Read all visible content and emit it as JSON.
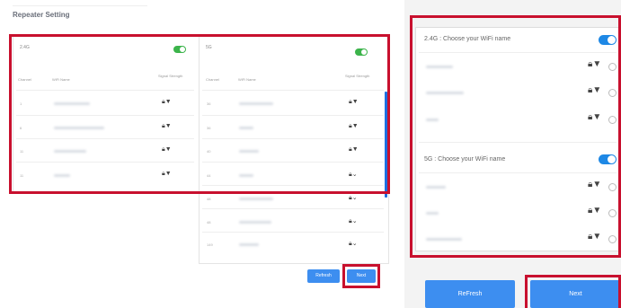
{
  "page": {
    "title": "Repeater Setting"
  },
  "left_panel": {
    "band_24": "2.4G",
    "band_5": "5G",
    "headers": {
      "channel": "Channel",
      "wifi_name": "WiFi Name",
      "signal": "Signal Strength"
    },
    "rows_24": [
      {
        "channel": "1"
      },
      {
        "channel": "6"
      },
      {
        "channel": "11"
      },
      {
        "channel": "11"
      }
    ],
    "rows_5": [
      {
        "channel": "36"
      },
      {
        "channel": "36"
      },
      {
        "channel": "40"
      },
      {
        "channel": "44"
      },
      {
        "channel": "48"
      },
      {
        "channel": "48"
      },
      {
        "channel": "149"
      }
    ],
    "refresh_label": "Refresh",
    "next_label": "Next"
  },
  "right_panel": {
    "section_24_title": "2.4G : Choose your WiFi name",
    "section_5_title": "5G : Choose your WiFi name",
    "refresh_label": "ReFresh",
    "next_label": "Next"
  },
  "icons": {
    "lock": "lock-icon",
    "wifi": "wifi-icon"
  },
  "colors": {
    "highlight": "#c8102e",
    "primary": "#3d8ef0",
    "toggle_green": "#3cb44b",
    "toggle_blue": "#1e88e5"
  }
}
